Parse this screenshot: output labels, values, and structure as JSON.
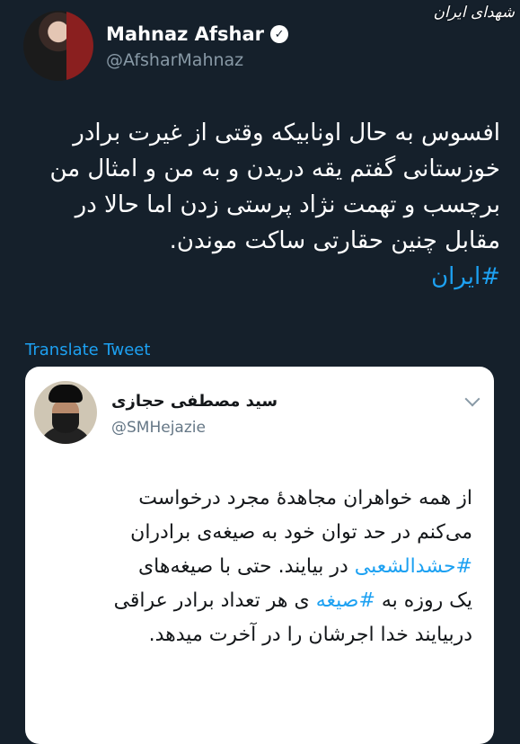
{
  "watermark": "شهدای ایران",
  "tweet": {
    "author_name": "Mahnaz Afshar",
    "handle": "@AfsharMahnaz",
    "lines": [
      "افسوس به حال اونابیکه وقتی از غیرت برادر",
      "خوزستانی گفتم یقه دریدن و به من و امثال من",
      "برچسب و تهمت نژاد پرستی زدن اما حالا در",
      "مقابل چنین حقارتی ساکت موندن."
    ],
    "hashtag": "#ایران",
    "translate_label": "Translate Tweet"
  },
  "quoted": {
    "author_name": "سید مصطفی حجازی",
    "handle": "@SMHejazie",
    "lines": [
      {
        "parts": [
          {
            "t": "از همه خواهران مجاهدهٔ مجرد درخواست",
            "tag": false
          }
        ]
      },
      {
        "parts": [
          {
            "t": "می‌کنم در حد توان خود به صیغه‌ی برادران",
            "tag": false
          }
        ]
      },
      {
        "parts": [
          {
            "t": "#حشدالشعبی",
            "tag": true
          },
          {
            "t": " در بیایند. حتی با صیغه‌های",
            "tag": false
          }
        ]
      },
      {
        "parts": [
          {
            "t": "یک روزه به ",
            "tag": false
          },
          {
            "t": "#صیغه",
            "tag": true
          },
          {
            "t": " ی هر تعداد برادر عراقی",
            "tag": false
          }
        ]
      },
      {
        "parts": [
          {
            "t": "دربیایند خدا اجرشان را در آخرت میدهد.",
            "tag": false
          }
        ]
      }
    ]
  },
  "colors": {
    "background": "#15202b",
    "link": "#1da1f2",
    "card": "#ffffff"
  }
}
